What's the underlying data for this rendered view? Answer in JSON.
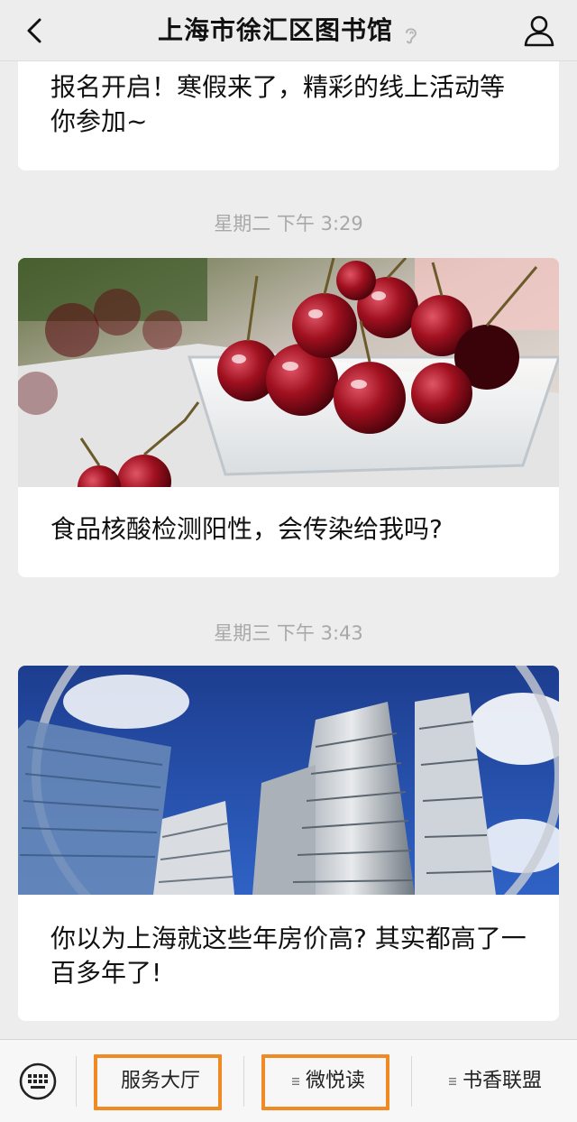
{
  "header": {
    "title": "上海市徐汇区图书馆"
  },
  "feed": {
    "card0": {
      "caption": "报名开启！寒假来了，精彩的线上活动等你参加~"
    },
    "time1": "星期二 下午 3:29",
    "card1": {
      "caption": "食品核酸检测阳性，会传染给我吗?"
    },
    "time2": "星期三 下午 3:43",
    "card2": {
      "caption": "你以为上海就这些年房价高? 其实都高了一百多年了!"
    }
  },
  "bottom_menu": {
    "items": [
      {
        "label": "服务大厅",
        "highlighted": true,
        "has_submenu": false
      },
      {
        "label": "微悦读",
        "highlighted": true,
        "has_submenu": true
      },
      {
        "label": "书香联盟",
        "highlighted": false,
        "has_submenu": true
      }
    ],
    "highlight_color": "#f08a24"
  },
  "icons": {
    "back": "chevron-left-icon",
    "ear": "ear-icon",
    "profile": "person-icon",
    "keyboard": "keyboard-icon",
    "submenu": "menu-lines-icon"
  }
}
